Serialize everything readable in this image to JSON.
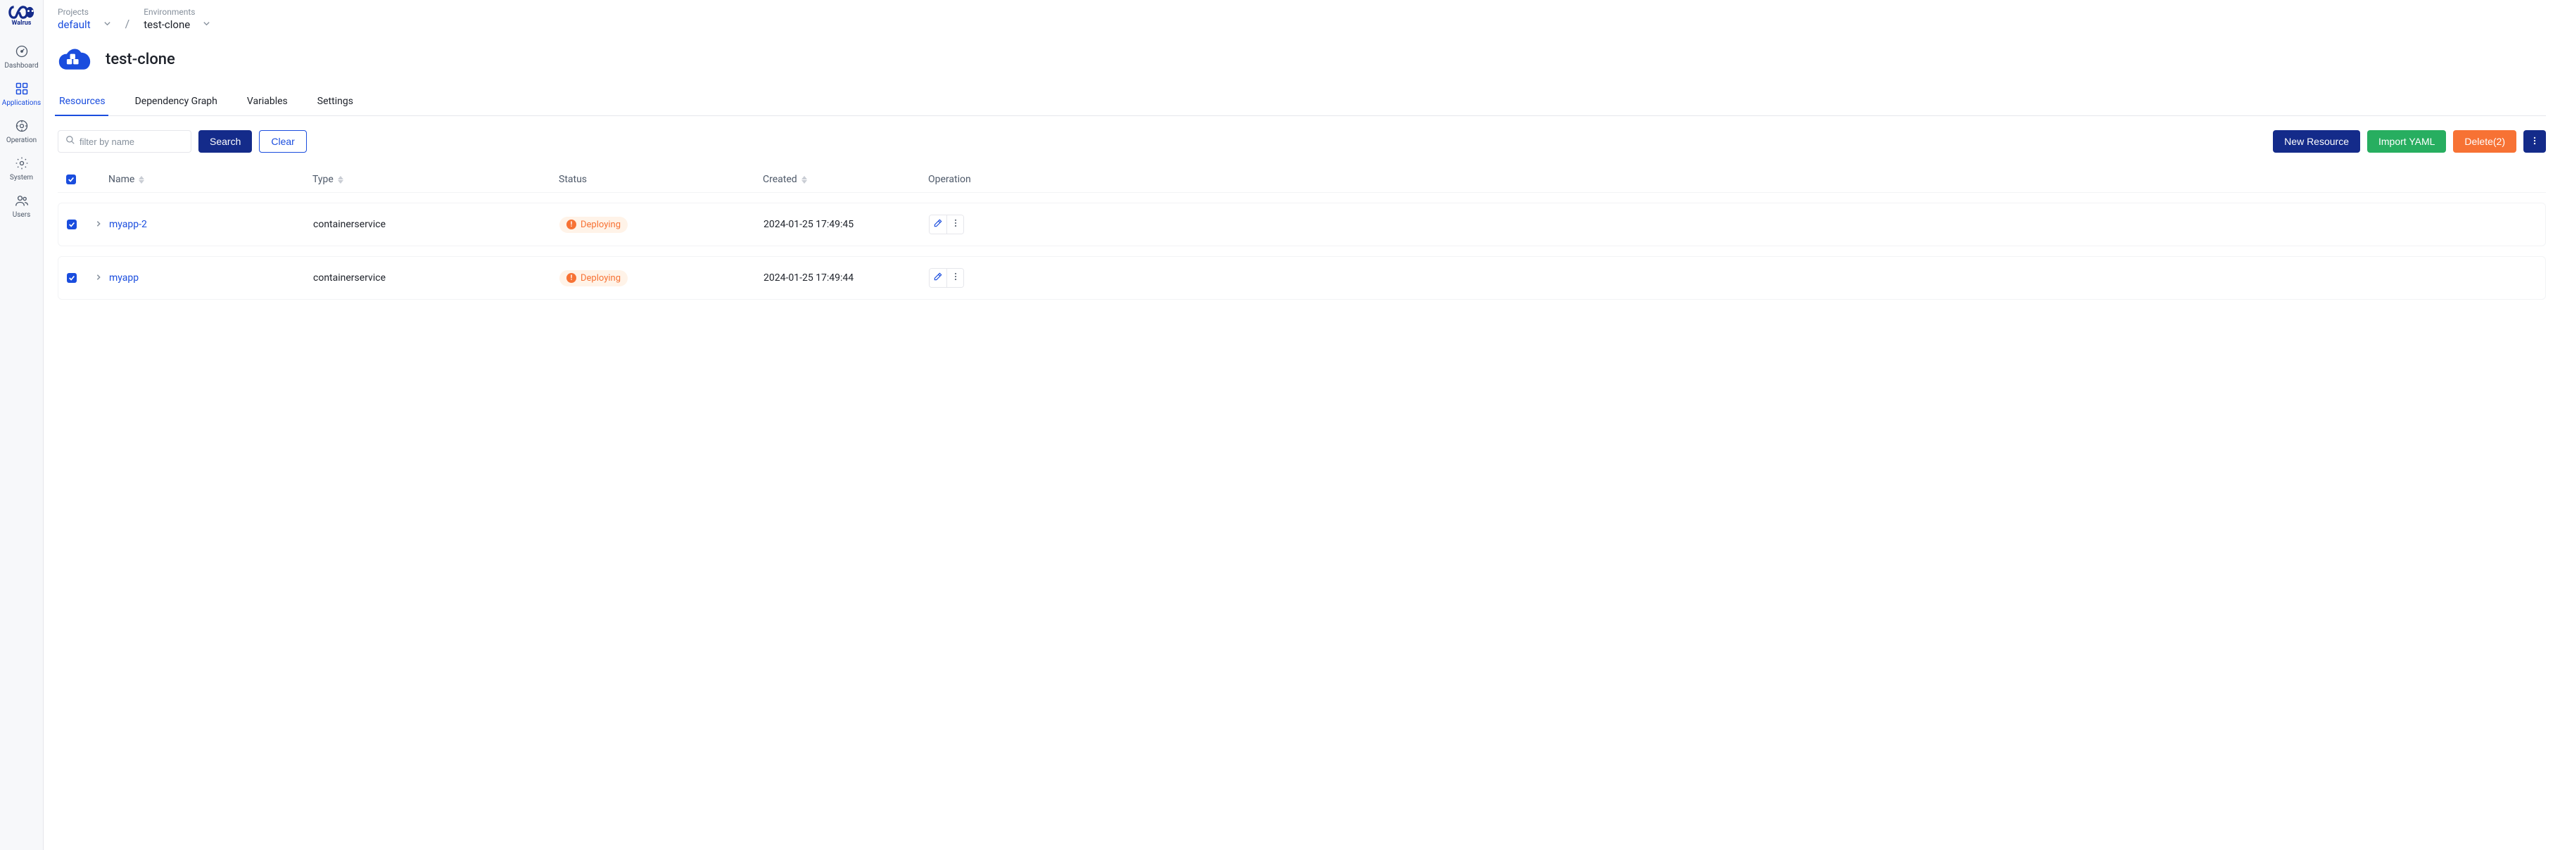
{
  "brand": "Walrus",
  "sidebar": {
    "items": [
      {
        "label": "Dashboard"
      },
      {
        "label": "Applications"
      },
      {
        "label": "Operation"
      },
      {
        "label": "System"
      },
      {
        "label": "Users"
      }
    ]
  },
  "breadcrumb": {
    "projects_label": "Projects",
    "projects_value": "default",
    "environments_label": "Environments",
    "environments_value": "test-clone"
  },
  "page": {
    "title": "test-clone"
  },
  "tabs": [
    {
      "label": "Resources"
    },
    {
      "label": "Dependency Graph"
    },
    {
      "label": "Variables"
    },
    {
      "label": "Settings"
    }
  ],
  "toolbar": {
    "filter_placeholder": "filter by name",
    "search_label": "Search",
    "clear_label": "Clear",
    "new_resource_label": "New Resource",
    "import_yaml_label": "Import YAML",
    "delete_label": "Delete(2)"
  },
  "table": {
    "columns": {
      "name": "Name",
      "type": "Type",
      "status": "Status",
      "created": "Created",
      "operation": "Operation"
    },
    "rows": [
      {
        "name": "myapp-2",
        "type": "containerservice",
        "status": "Deploying",
        "created": "2024-01-25 17:49:45"
      },
      {
        "name": "myapp",
        "type": "containerservice",
        "status": "Deploying",
        "created": "2024-01-25 17:49:44"
      }
    ]
  }
}
